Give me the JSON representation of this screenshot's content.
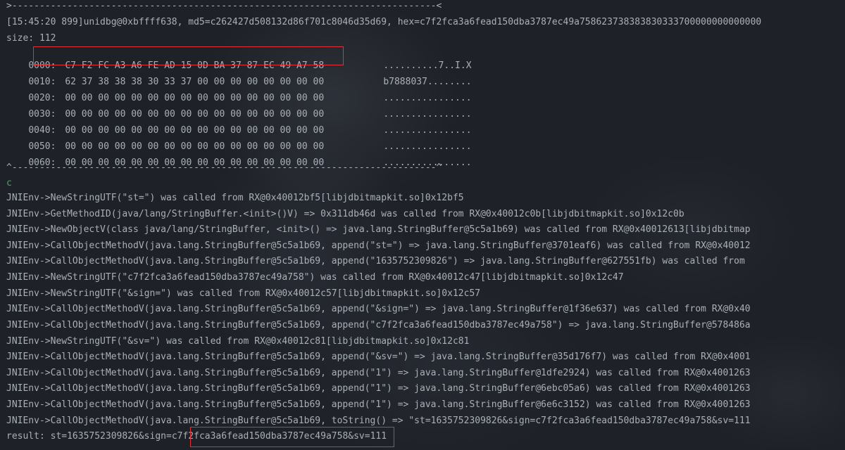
{
  "colors": {
    "background": "#1e2127",
    "text": "#a9b0b8",
    "prompt_green": "#3fae4f",
    "highlight_red": "#e0313a"
  },
  "header": {
    "top_rule": ">-----------------------------------------------------------------------------<",
    "debug_info": "[15:45:20 899]unidbg@0xbffff638, md5=c262427d508132d86f701c8046d35d69, hex=c7f2fca3a6fead150dba3787ec49a758623738383830333700000000000000",
    "size": "size: 112"
  },
  "hexdump": [
    {
      "offset": "0000:",
      "bytes": "C7 F2 FC A3 A6 FE AD 15 0D BA 37 87 EC 49 A7 58",
      "ascii": "..........7..I.X"
    },
    {
      "offset": "0010:",
      "bytes": "62 37 38 38 38 30 33 37 00 00 00 00 00 00 00 00",
      "ascii": "b7888037........"
    },
    {
      "offset": "0020:",
      "bytes": "00 00 00 00 00 00 00 00 00 00 00 00 00 00 00 00",
      "ascii": "................"
    },
    {
      "offset": "0030:",
      "bytes": "00 00 00 00 00 00 00 00 00 00 00 00 00 00 00 00",
      "ascii": "................"
    },
    {
      "offset": "0040:",
      "bytes": "00 00 00 00 00 00 00 00 00 00 00 00 00 00 00 00",
      "ascii": "................"
    },
    {
      "offset": "0050:",
      "bytes": "00 00 00 00 00 00 00 00 00 00 00 00 00 00 00 00",
      "ascii": "................"
    },
    {
      "offset": "0060:",
      "bytes": "00 00 00 00 00 00 00 00 00 00 00 00 00 00 00 00",
      "ascii": "................"
    }
  ],
  "bottom_rule": "^-----------------------------------------------------------------------------^",
  "prompt": "c",
  "log_lines": [
    "JNIEnv->NewStringUTF(\"st=\") was called from RX@0x40012bf5[libjdbitmapkit.so]0x12bf5",
    "JNIEnv->GetMethodID(java/lang/StringBuffer.<init>()V) => 0x311db46d was called from RX@0x40012c0b[libjdbitmapkit.so]0x12c0b",
    "JNIEnv->NewObjectV(class java/lang/StringBuffer, <init>() => java.lang.StringBuffer@5c5a1b69) was called from RX@0x40012613[libjdbitmap",
    "JNIEnv->CallObjectMethodV(java.lang.StringBuffer@5c5a1b69, append(\"st=\") => java.lang.StringBuffer@3701eaf6) was called from RX@0x40012",
    "JNIEnv->CallObjectMethodV(java.lang.StringBuffer@5c5a1b69, append(\"1635752309826\") => java.lang.StringBuffer@627551fb) was called from",
    "JNIEnv->NewStringUTF(\"c7f2fca3a6fead150dba3787ec49a758\") was called from RX@0x40012c47[libjdbitmapkit.so]0x12c47",
    "JNIEnv->NewStringUTF(\"&sign=\") was called from RX@0x40012c57[libjdbitmapkit.so]0x12c57",
    "JNIEnv->CallObjectMethodV(java.lang.StringBuffer@5c5a1b69, append(\"&sign=\") => java.lang.StringBuffer@1f36e637) was called from RX@0x40",
    "JNIEnv->CallObjectMethodV(java.lang.StringBuffer@5c5a1b69, append(\"c7f2fca3a6fead150dba3787ec49a758\") => java.lang.StringBuffer@578486a",
    "JNIEnv->NewStringUTF(\"&sv=\") was called from RX@0x40012c81[libjdbitmapkit.so]0x12c81",
    "JNIEnv->CallObjectMethodV(java.lang.StringBuffer@5c5a1b69, append(\"&sv=\") => java.lang.StringBuffer@35d176f7) was called from RX@0x4001",
    "JNIEnv->CallObjectMethodV(java.lang.StringBuffer@5c5a1b69, append(\"1\") => java.lang.StringBuffer@1dfe2924) was called from RX@0x4001263",
    "JNIEnv->CallObjectMethodV(java.lang.StringBuffer@5c5a1b69, append(\"1\") => java.lang.StringBuffer@6ebc05a6) was called from RX@0x4001263",
    "JNIEnv->CallObjectMethodV(java.lang.StringBuffer@5c5a1b69, append(\"1\") => java.lang.StringBuffer@6e6c3152) was called from RX@0x4001263",
    "JNIEnv->CallObjectMethodV(java.lang.StringBuffer@5c5a1b69, toString() => \"st=1635752309826&sign=c7f2fca3a6fead150dba3787ec49a758&sv=111"
  ],
  "result": {
    "prefix": "result: st=1635752309826&sign=",
    "sign": "c7f2fca3a6fead150dba3787ec49a758",
    "suffix": "&sv=111"
  }
}
